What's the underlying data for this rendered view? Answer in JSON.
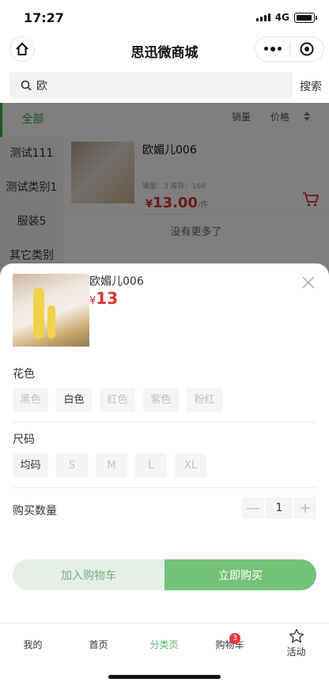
{
  "status": {
    "time": "17:27",
    "network": "4G"
  },
  "nav": {
    "title": "思迅微商城"
  },
  "search": {
    "value": "欧",
    "button": "搜索"
  },
  "sidebar": {
    "items": [
      "全部",
      "测试111",
      "测试类别1",
      "服装5",
      "其它类别"
    ]
  },
  "sort": {
    "sales": "销量",
    "price": "价格"
  },
  "product": {
    "name": "欧媚儿006",
    "meta": "销量：3   库存：160",
    "currency": "¥",
    "price": "13.00",
    "unit": "/件"
  },
  "list_end": "没有更多了",
  "sheet": {
    "name": "欧媚儿006",
    "currency": "¥",
    "price": "13",
    "color_title": "花色",
    "colors": [
      "黑色",
      "白色",
      "红色",
      "紫色",
      "粉红"
    ],
    "size_title": "尺码",
    "sizes": [
      "均码",
      "S",
      "M",
      "L",
      "XL"
    ],
    "qty_label": "购买数量",
    "qty_minus": "—",
    "qty_value": "1",
    "qty_plus": "+",
    "add_cart": "加入购物车",
    "buy_now": "立即购买"
  },
  "tabs": {
    "mine": "我的",
    "home": "首页",
    "category": "分类页",
    "cart": "购物车",
    "cart_badge": "3",
    "activity": "活动"
  },
  "colors": {
    "accent": "#74c17a",
    "price": "#dd3333"
  }
}
